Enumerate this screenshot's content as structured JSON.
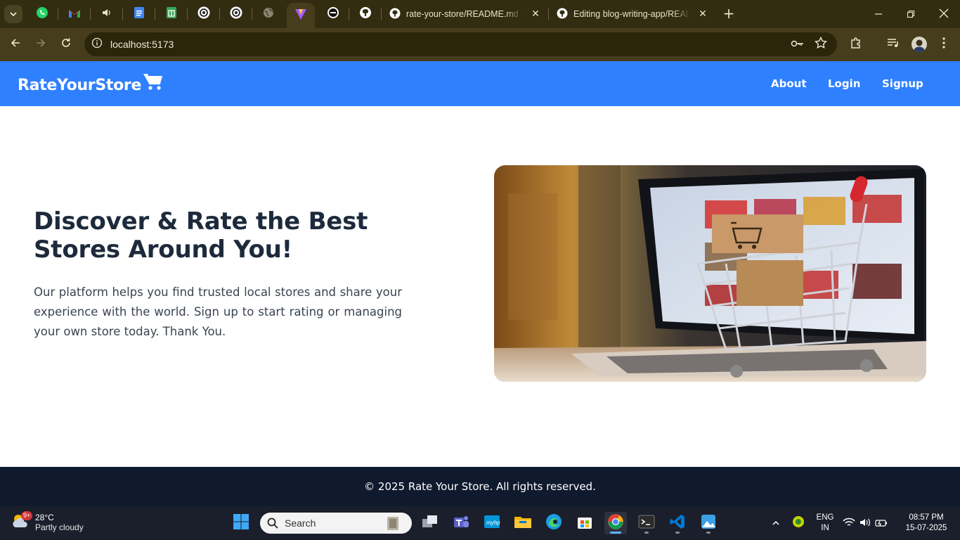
{
  "browser": {
    "tabs": [
      {
        "title": "rate-your-store/README.md at",
        "icon": "github-icon"
      },
      {
        "title": "Editing blog-writing-app/READM",
        "icon": "github-icon"
      }
    ],
    "pinned_tabs": [
      "whatsapp-icon",
      "gmail-icon",
      "audio-icon",
      "google-docs-icon",
      "google-sheets-icon",
      "openai-icon",
      "openai-icon",
      "globe-icon",
      "vite-icon",
      "dark-circle-icon",
      "github-icon"
    ],
    "url": "localhost:5173"
  },
  "site": {
    "brand": "RateYourStore",
    "nav": {
      "about": "About",
      "login": "Login",
      "signup": "Signup"
    },
    "hero": {
      "title": "Discover & Rate the Best Stores Around You!",
      "text": "Our platform helps you find trusted local stores and share your experience with the world. Sign up to start rating or managing your own store today. Thank You."
    },
    "footer": "© 2025 Rate Your Store. All rights reserved."
  },
  "colors": {
    "header": "#2f80ff",
    "footer": "#101a2e",
    "title": "#1d2a3b",
    "chrome_tabstrip": "#322c11",
    "chrome_toolbar": "#453d1c"
  },
  "taskbar": {
    "weather": {
      "temp": "28°C",
      "desc": "Partly cloudy",
      "badge": "9+"
    },
    "search_placeholder": "Search",
    "lang": {
      "line1": "ENG",
      "line2": "IN"
    },
    "time": "08:57 PM",
    "date": "15-07-2025"
  }
}
